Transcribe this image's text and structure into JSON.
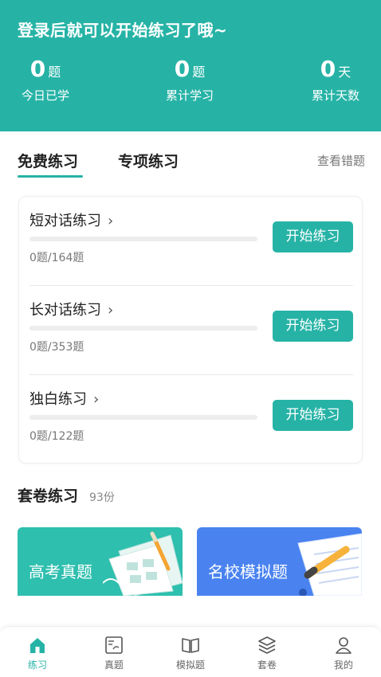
{
  "header": {
    "title": "登录后就可以开始练习了哦~",
    "stats": [
      {
        "value": "0",
        "unit": "题",
        "label": "今日已学"
      },
      {
        "value": "0",
        "unit": "题",
        "label": "累计学习"
      },
      {
        "value": "0",
        "unit": "天",
        "label": "累计天数"
      }
    ]
  },
  "tabs": {
    "free": "免费练习",
    "special": "专项练习",
    "view_wrong": "查看错题"
  },
  "practice": [
    {
      "name": "短对话练习",
      "count": "0题/164题",
      "progress": 0,
      "button": "开始练习"
    },
    {
      "name": "长对话练习",
      "count": "0题/353题",
      "progress": 0,
      "button": "开始练习"
    },
    {
      "name": "独白练习",
      "count": "0题/122题",
      "progress": 0,
      "button": "开始练习"
    }
  ],
  "sets": {
    "title": "套卷练习",
    "count": "93份",
    "tiles": [
      {
        "label": "高考真题"
      },
      {
        "label": "名校模拟题"
      }
    ]
  },
  "nav": [
    {
      "label": "练习",
      "icon": "home-icon",
      "active": true
    },
    {
      "label": "真题",
      "icon": "exam-paper-icon",
      "active": false
    },
    {
      "label": "模拟题",
      "icon": "book-icon",
      "active": false
    },
    {
      "label": "套卷",
      "icon": "layers-icon",
      "active": false
    },
    {
      "label": "我的",
      "icon": "user-icon",
      "active": false
    }
  ],
  "colors": {
    "accent": "#26b3a6",
    "tile_gaokao": "#2ebfae",
    "tile_mock": "#4a83f0"
  }
}
